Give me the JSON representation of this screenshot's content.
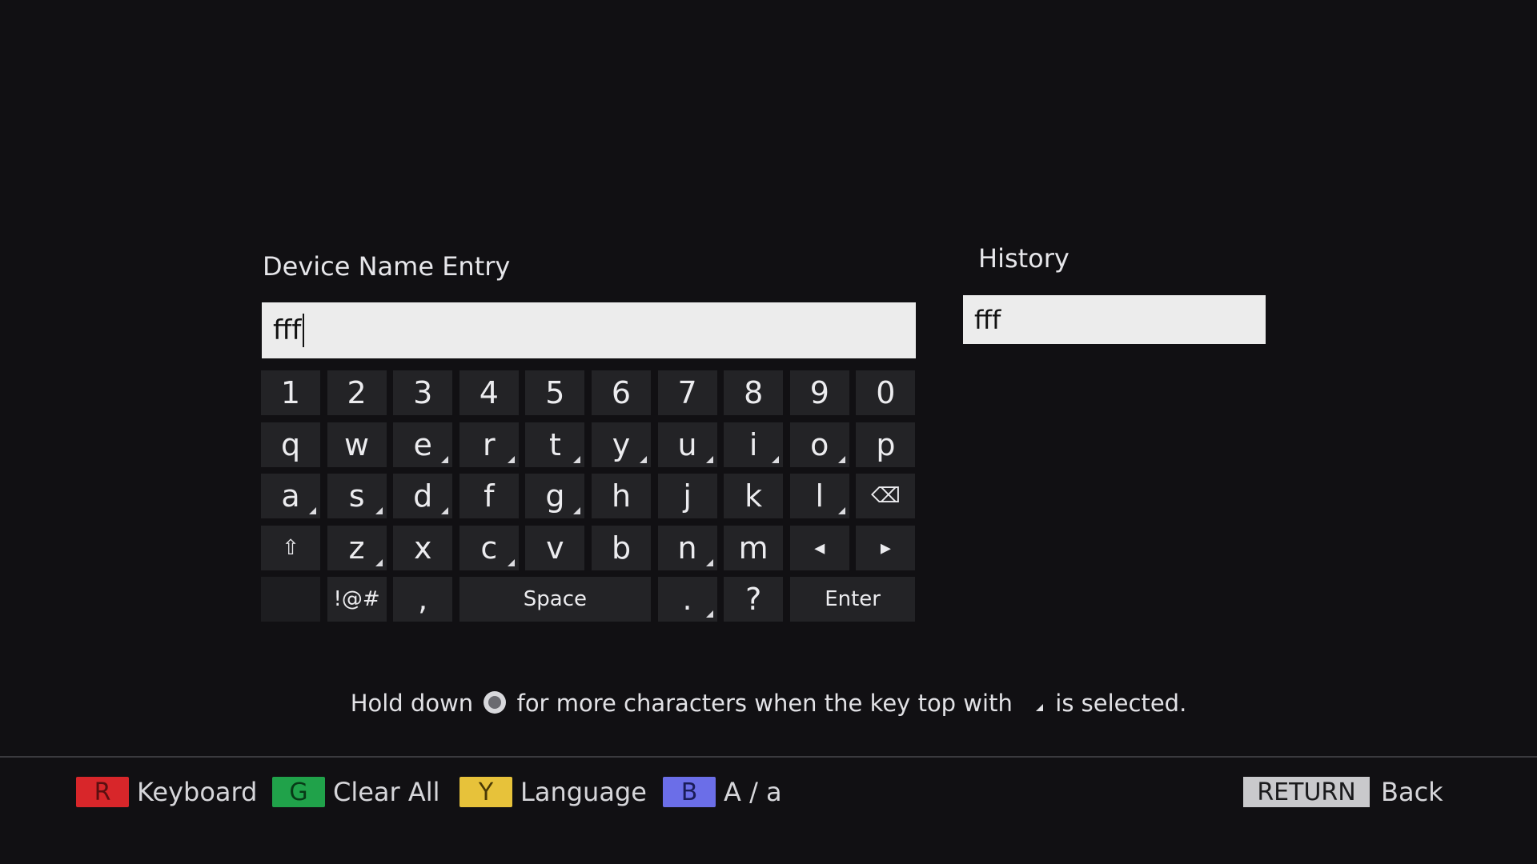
{
  "entry": {
    "title": "Device Name Entry",
    "value": "fff"
  },
  "history": {
    "title": "History",
    "items": [
      "fff"
    ]
  },
  "keyboard": {
    "rows": [
      [
        "1",
        "2",
        "3",
        "4",
        "5",
        "6",
        "7",
        "8",
        "9",
        "0"
      ],
      [
        "q",
        "w",
        "e",
        "r",
        "t",
        "y",
        "u",
        "i",
        "o",
        "p"
      ],
      [
        "a",
        "s",
        "d",
        "f",
        "g",
        "h",
        "j",
        "k",
        "l",
        "⌫"
      ],
      [
        "⇧",
        "z",
        "x",
        "c",
        "v",
        "b",
        "n",
        "m",
        "◂",
        "▸"
      ]
    ],
    "more_chars": [
      "e",
      "r",
      "t",
      "y",
      "u",
      "i",
      "o",
      "a",
      "s",
      "d",
      "g",
      "l",
      "z",
      "c",
      "n",
      "."
    ],
    "bottom": {
      "symbols": "!@#",
      "comma": ",",
      "space": "Space",
      "period": ".",
      "question": "?",
      "enter": "Enter"
    }
  },
  "hint": {
    "part1": "Hold down",
    "part2": "for more characters when the key top with",
    "part3": "is selected."
  },
  "footer": {
    "red": {
      "key": "R",
      "label": "Keyboard",
      "color": "#d8262a"
    },
    "green": {
      "key": "G",
      "label": "Clear All",
      "color": "#20a24a"
    },
    "yellow": {
      "key": "Y",
      "label": "Language",
      "color": "#e7c23a"
    },
    "blue": {
      "key": "B",
      "label": "A / a",
      "color": "#6b6ee8"
    },
    "return": {
      "key": "RETURN",
      "label": "Back"
    }
  },
  "icons": {
    "backspace": "backspace-icon",
    "shift": "shift-icon",
    "left": "arrow-left-icon",
    "right": "arrow-right-icon",
    "dpad": "dpad-icon"
  }
}
